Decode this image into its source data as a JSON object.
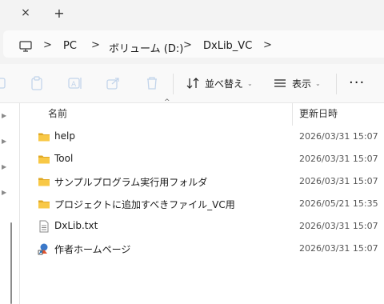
{
  "tabbar": {
    "close_icon": "×",
    "new_tab_icon": "+"
  },
  "address": {
    "icon": "monitor-icon",
    "crumbs": [
      "PC",
      "ボリューム (D:)",
      "DxLib_VC"
    ],
    "separator": ">"
  },
  "toolbar": {
    "icons": [
      "paste-icon",
      "rename-icon",
      "share-icon",
      "delete-icon"
    ],
    "sort_label": "並べ替え",
    "view_label": "表示",
    "more_label": "···",
    "dropdown_glyph": "⌄"
  },
  "columns": {
    "name": "名前",
    "modified": "更新日時",
    "sort_caret": "^"
  },
  "files": [
    {
      "name": "help",
      "date": "2026/03/31 15:07",
      "type": "folder"
    },
    {
      "name": "Tool",
      "date": "2026/03/31 15:07",
      "type": "folder"
    },
    {
      "name": "サンプルプログラム実行用フォルダ",
      "date": "2026/03/31 15:07",
      "type": "folder"
    },
    {
      "name": "プロジェクトに追加すべきファイル_VC用",
      "date": "2026/05/21 15:35",
      "type": "folder"
    },
    {
      "name": "DxLib.txt",
      "date": "2026/03/31 15:07",
      "type": "text-file"
    },
    {
      "name": "作者ホームページ",
      "date": "2026/03/31 15:07",
      "type": "shortcut"
    }
  ],
  "colors": {
    "folder": "#f8c846",
    "folder_dark": "#e0a824",
    "accent": "#005fb8"
  }
}
